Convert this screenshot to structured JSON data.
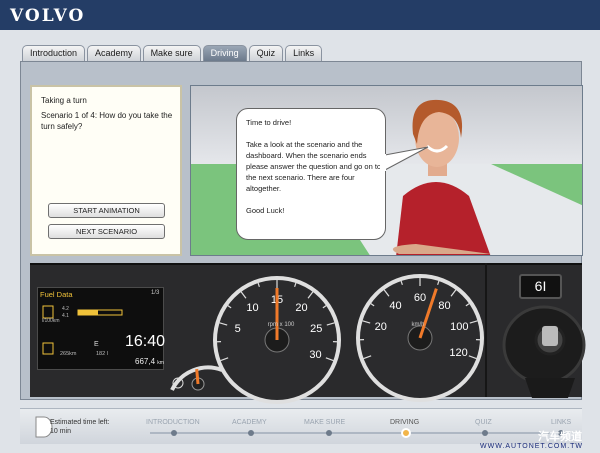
{
  "brand": {
    "logo": "VOLVO",
    "color": "#243d66"
  },
  "tabs": [
    {
      "label": "Introduction",
      "active": false
    },
    {
      "label": "Academy",
      "active": false
    },
    {
      "label": "Make sure",
      "active": false
    },
    {
      "label": "Driving",
      "active": true
    },
    {
      "label": "Quiz",
      "active": false
    },
    {
      "label": "Links",
      "active": false
    }
  ],
  "scenario": {
    "title": "Taking a turn",
    "question": "Scenario 1 of 4: How do you take the turn safely?",
    "start_button": "START ANIMATION",
    "next_button": "NEXT SCENARIO"
  },
  "speech": {
    "text": "Time to drive!\n\nTake a look at the scenario and the dashboard. When the scenario ends please answer the question and go on to the next scenario. There are four altogether.\n\nGood Luck!"
  },
  "dashboard": {
    "fuel": {
      "title": "Fuel Data",
      "page": "1/3",
      "row1_a": "4.2",
      "row1_b": "4.1",
      "row1_unit": "l/100km",
      "clock": "16:40",
      "dest": "E",
      "dist1": "265km",
      "dist2": "182 l",
      "odometer": "667,4",
      "odometer_unit": "km"
    },
    "tach": {
      "ticks": [
        "5",
        "10",
        "15",
        "20",
        "25",
        "30"
      ],
      "label": "rpm x 100",
      "needle_value": 15
    },
    "speedo": {
      "ticks": [
        "20",
        "40",
        "60",
        "80",
        "100",
        "120"
      ],
      "unit": "km/h",
      "needle_value": 70
    },
    "fuel_gauge": {
      "level": 0.5
    },
    "gear": "6I",
    "accent_color": "#f07a2a"
  },
  "progress": {
    "time_left_label": "Estimated time left:",
    "time_left_value": "10 min",
    "steps": [
      {
        "label": "INTRODUCTION",
        "active": false
      },
      {
        "label": "ACADEMY",
        "active": false
      },
      {
        "label": "MAKE SURE",
        "active": false
      },
      {
        "label": "DRIVING",
        "active": true
      },
      {
        "label": "QUIZ",
        "active": false
      },
      {
        "label": "LINKS",
        "active": false
      }
    ]
  },
  "watermark": {
    "url": "WWW.AUTONET.COM.TW",
    "cn": "汽车频道"
  }
}
